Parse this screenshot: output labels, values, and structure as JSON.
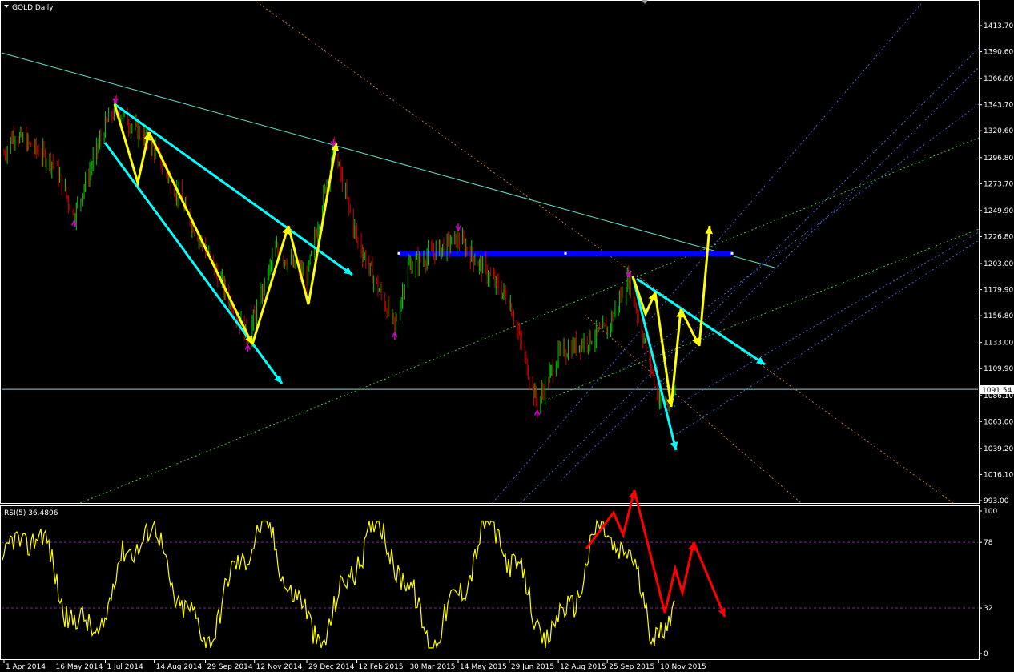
{
  "chart_title": "GOLD,Daily",
  "current_price_label": "1091.54",
  "rsi_label": "RSI(5) 36.4806",
  "colors": {
    "background": "#000000",
    "candle_up": "#00cc00",
    "candle_down": "#cc0000",
    "rsi_line": "#ffff00",
    "trend_cyan": "#00ffff",
    "zigzag_yellow": "#ffff00",
    "resistance_blue": "#0000ff",
    "rsi_arrows": "#ff0000",
    "fractal_marker": "#cc00cc"
  },
  "chart_data": [
    {
      "type": "candlestick",
      "symbol": "GOLD",
      "timeframe": "Daily",
      "y_ticks": [
        "1413.70",
        "1390.60",
        "1366.80",
        "1343.70",
        "1320.60",
        "1296.80",
        "1273.70",
        "1249.90",
        "1226.80",
        "1203.00",
        "1179.90",
        "1156.80",
        "1133.00",
        "1109.90",
        "1086.10",
        "1063.00",
        "1039.20",
        "1016.10",
        "993.00"
      ],
      "ylim": [
        993.0,
        1413.7
      ],
      "x_ticks": [
        "1 Apr 2014",
        "16 May 2014",
        "1 Jul 2014",
        "14 Aug 2014",
        "29 Sep 2014",
        "12 Nov 2014",
        "29 Dec 2014",
        "12 Feb 2015",
        "30 Mar 2015",
        "14 May 2015",
        "29 Jun 2015",
        "12 Aug 2015",
        "25 Sep 2015",
        "10 Nov 2015"
      ],
      "current_price": 1091.54,
      "price_path_keypoints": [
        {
          "x": "1 Apr 2014",
          "y": 1300
        },
        {
          "x": "10 Apr 2014",
          "y": 1318
        },
        {
          "x": "16 May 2014",
          "y": 1292
        },
        {
          "x": "3 Jun 2014",
          "y": 1245
        },
        {
          "x": "1 Jul 2014",
          "y": 1325
        },
        {
          "x": "10 Jul 2014",
          "y": 1340
        },
        {
          "x": "14 Aug 2014",
          "y": 1305
        },
        {
          "x": "29 Sep 2014",
          "y": 1215
        },
        {
          "x": "6 Nov 2014",
          "y": 1138
        },
        {
          "x": "1 Dec 2014",
          "y": 1215
        },
        {
          "x": "29 Dec 2014",
          "y": 1190
        },
        {
          "x": "22 Jan 2015",
          "y": 1305
        },
        {
          "x": "12 Feb 2015",
          "y": 1225
        },
        {
          "x": "18 Mar 2015",
          "y": 1147
        },
        {
          "x": "30 Mar 2015",
          "y": 1200
        },
        {
          "x": "14 May 2015",
          "y": 1225
        },
        {
          "x": "29 Jun 2015",
          "y": 1170
        },
        {
          "x": "24 Jul 2015",
          "y": 1078
        },
        {
          "x": "12 Aug 2015",
          "y": 1122
        },
        {
          "x": "25 Sep 2015",
          "y": 1145
        },
        {
          "x": "14 Oct 2015",
          "y": 1190
        },
        {
          "x": "10 Nov 2015",
          "y": 1085
        },
        {
          "x": "20 Nov 2015",
          "y": 1076
        },
        {
          "x": "25 Nov 2015",
          "y": 1091.54
        }
      ],
      "levels": [
        {
          "kind": "horizontal",
          "name": "resistance",
          "y": 1212
        },
        {
          "kind": "horizontal",
          "name": "current",
          "y": 1091.54
        }
      ],
      "fractals_up": [
        {
          "x": "10 Jul 2014",
          "y": 1345
        },
        {
          "x": "22 Jan 2015",
          "y": 1307
        },
        {
          "x": "14 May 2015",
          "y": 1232
        },
        {
          "x": "14 Oct 2015",
          "y": 1191
        }
      ],
      "fractals_down": [
        {
          "x": "3 Jun 2014",
          "y": 1241
        },
        {
          "x": "6 Nov 2014",
          "y": 1131
        },
        {
          "x": "18 Mar 2015",
          "y": 1142
        },
        {
          "x": "24 Jul 2015",
          "y": 1073
        }
      ]
    },
    {
      "type": "line",
      "indicator": "RSI(5)",
      "last_value": 36.4806,
      "y_ticks": [
        "100",
        "78",
        "32",
        "0"
      ],
      "ylim": [
        0,
        100
      ],
      "levels": [
        78,
        32
      ],
      "rsi_shape": {
        "oscillates_between": [
          5,
          92
        ],
        "last_value": 36.4806
      }
    }
  ]
}
